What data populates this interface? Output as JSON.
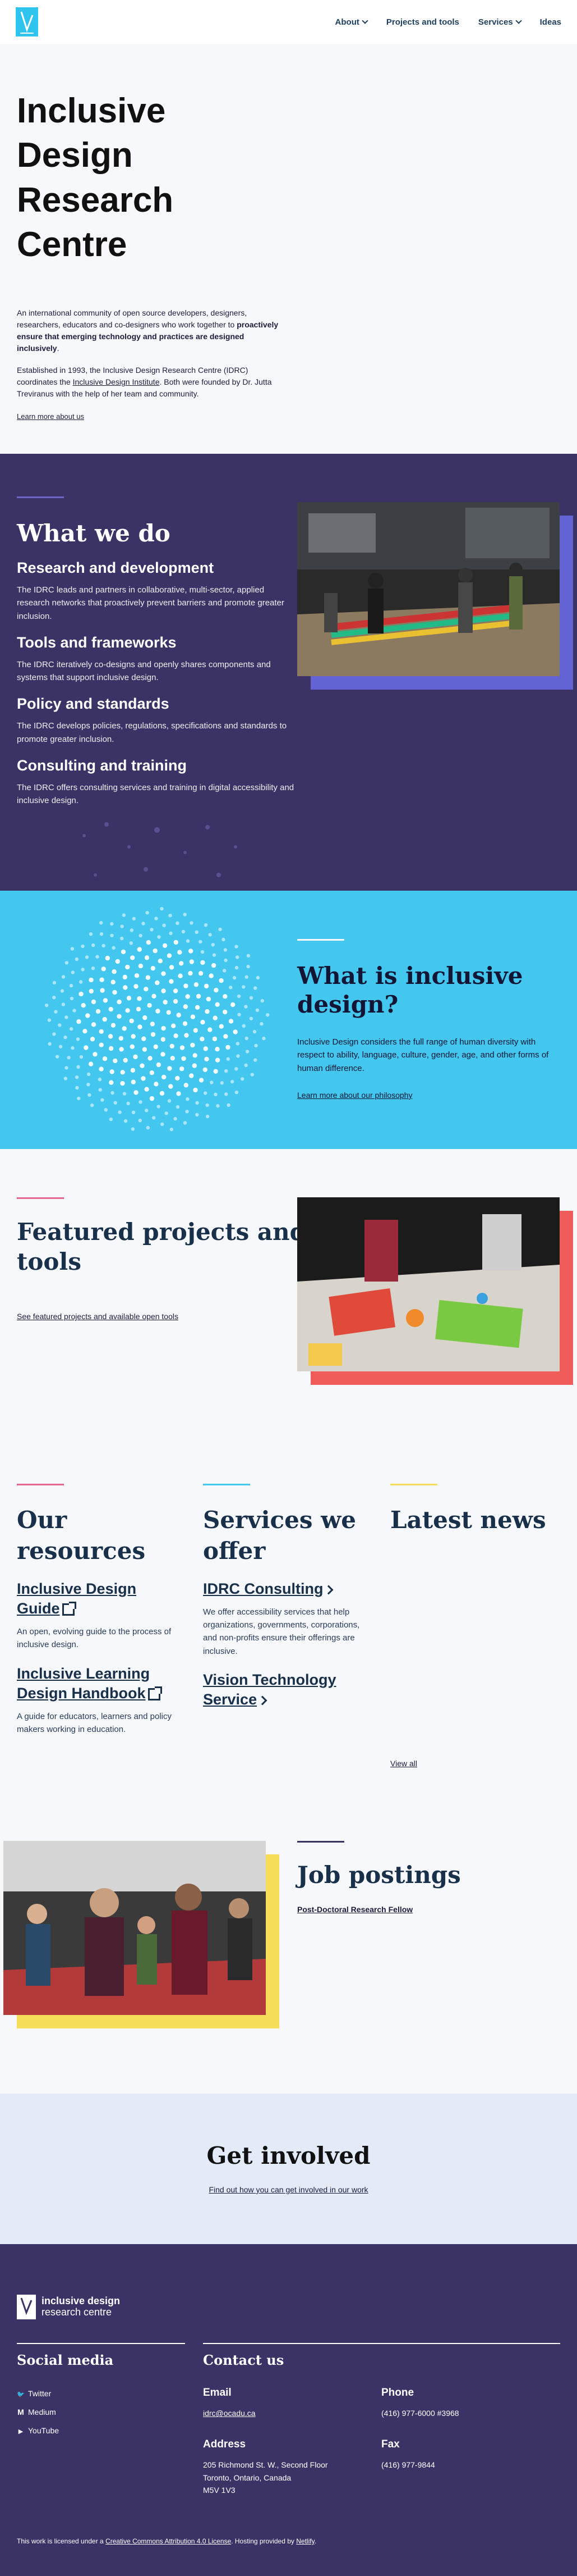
{
  "header": {
    "nav": [
      {
        "label": "About",
        "has_menu": true
      },
      {
        "label": "Projects and tools",
        "has_menu": false
      },
      {
        "label": "Services",
        "has_menu": true
      },
      {
        "label": "Ideas",
        "has_menu": false
      }
    ]
  },
  "hero": {
    "title": "Inclusive Design Research Centre",
    "intro_a": "An international community of open source developers, designers, researchers, educators and co-designers who work together to ",
    "intro_b": "proactively ensure that emerging technology and practices are designed inclusively",
    "intro_c": ".",
    "history_a": "Established in 1993, the Inclusive Design Research Centre (IDRC) coordinates the ",
    "history_link": "Inclusive Design Institute",
    "history_b": ". Both were founded by Dr. Jutta Treviranus with the help of her team and community.",
    "learn_more": "Learn more about us"
  },
  "what_we_do": {
    "title": "What we do",
    "items": [
      {
        "heading": "Research and development",
        "text": "The IDRC leads and partners in collaborative, multi-sector, applied research networks that proactively prevent barriers and promote greater inclusion."
      },
      {
        "heading": "Tools and frameworks",
        "text": "The IDRC iteratively co-designs and openly shares components and systems that support inclusive design."
      },
      {
        "heading": "Policy and standards",
        "text": "The IDRC develops policies, regulations, specifications and standards to promote greater inclusion."
      },
      {
        "heading": "Consulting and training",
        "text": "The IDRC offers consulting services and training in digital accessibility and inclusive design."
      }
    ]
  },
  "inclusive_design": {
    "title": "What is inclusive design?",
    "text": "Inclusive Design considers the full range of human diversity with respect to ability, language, culture, gender, age, and other forms of human difference.",
    "link": "Learn more about our philosophy"
  },
  "featured": {
    "title": "Featured projects and tools",
    "link": "See featured projects and available open tools"
  },
  "resources": {
    "title": "Our resources",
    "items": [
      {
        "label": "Inclusive Design Guide",
        "text": "An open, evolving guide to the process of inclusive design."
      },
      {
        "label": "Inclusive Learning Design Handbook",
        "text": "A guide for educators, learners and policy makers working in education."
      }
    ]
  },
  "services": {
    "title": "Services we offer",
    "items": [
      {
        "label": "IDRC Consulting",
        "text": "We offer accessibility services that help organizations, governments, corporations, and non-profits ensure their offerings are inclusive."
      },
      {
        "label": "Vision Technology Service",
        "text": ""
      }
    ]
  },
  "news": {
    "title": "Latest news",
    "view_all": "View all"
  },
  "jobs": {
    "title": "Job postings",
    "link": "Post-Doctoral Research Fellow"
  },
  "get_involved": {
    "title": "Get involved",
    "link": "Find out how you can get involved in our work"
  },
  "footer": {
    "logo_line1": "inclusive design",
    "logo_line2": "research centre",
    "social_title": "Social media",
    "social": [
      {
        "icon": "twitter-icon",
        "glyph": "🐦",
        "label": "Twitter"
      },
      {
        "icon": "medium-icon",
        "glyph": "M",
        "label": "Medium"
      },
      {
        "icon": "youtube-icon",
        "glyph": "▶",
        "label": "YouTube"
      }
    ],
    "contact_title": "Contact us",
    "email_label": "Email",
    "email": "idrc@ocadu.ca",
    "phone_label": "Phone",
    "phone": "(416) 977-6000 #3968",
    "address_label": "Address",
    "address": [
      "205 Richmond St. W., Second Floor",
      "Toronto, Ontario, Canada",
      "M5V 1V3"
    ],
    "fax_label": "Fax",
    "fax": "(416) 977-9844",
    "license_a": "This work is licensed under a ",
    "license_link": "Creative Commons Attribution 4.0 License",
    "license_b": ". Hosting provided by ",
    "host_link": "Netlify",
    "license_c": "."
  },
  "colors": {
    "purple": "#3b3365",
    "cyan": "#43c7ef",
    "pink": "#e5678f",
    "red": "#f05c5a",
    "yellow": "#f7dd5a",
    "light": "#e2ebf7"
  }
}
